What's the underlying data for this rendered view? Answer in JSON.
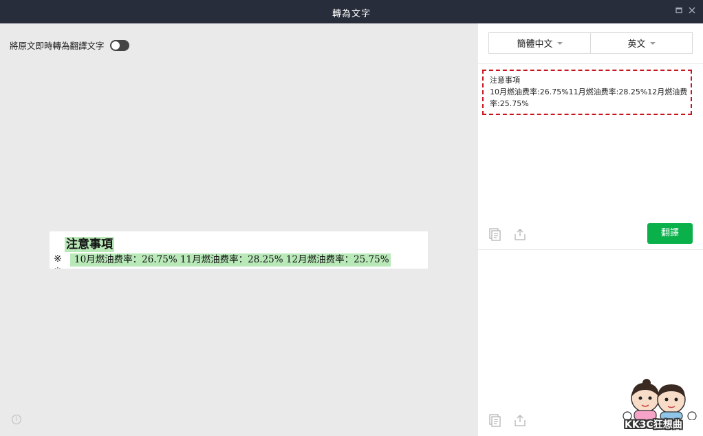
{
  "window": {
    "title": "轉為文字",
    "restore_icon": "restore-icon",
    "close_icon": "close-icon"
  },
  "left_panel": {
    "toggle_label": "將原文即時轉為翻譯文字",
    "toggle_on": false,
    "document": {
      "heading": "注意事項",
      "bullet": "※",
      "line": "10月燃油费率：26.75% 11月燃油费率：28.25% 12月燃油费率：25.75%"
    }
  },
  "right_panel": {
    "source_language": "簡體中文",
    "target_language": "英文",
    "result_lines": [
      "注意事項",
      "10月燃油费率:26.75%11月燃油费率:28.25%12月燃油费",
      "率:25.75%"
    ],
    "translate_button": "翻譯",
    "copy_icon": "copy-icon",
    "share_icon": "share-icon"
  },
  "watermark": {
    "text": "KK3C狂想曲"
  },
  "colors": {
    "titlebar": "#272d3a",
    "accent_green": "#0ab14b",
    "highlight": "#b9e8b9",
    "dashed_border": "#c8141e"
  }
}
